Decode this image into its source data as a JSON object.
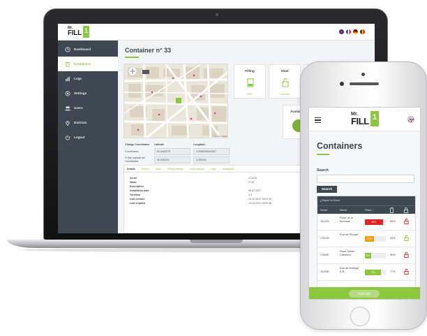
{
  "colors": {
    "brand_green": "#8dc63f",
    "sidebar_dark": "#3d4850",
    "fill_red": "#e02424",
    "fill_orange": "#f39c12",
    "fill_green": "#8dc63f"
  },
  "brand": {
    "logo_top": "Mr.",
    "logo_bottom": "FILL",
    "logo_badge": "1"
  },
  "desktop": {
    "sidebar": {
      "items": [
        {
          "label": "Dashboard",
          "icon": "clock-icon"
        },
        {
          "label": "Containers",
          "icon": "bin-icon"
        },
        {
          "label": "Logs",
          "icon": "bar-chart-icon"
        },
        {
          "label": "Settings",
          "icon": "gear-icon"
        },
        {
          "label": "Users",
          "icon": "users-icon"
        },
        {
          "label": "Districts",
          "icon": "map-pin-icon"
        },
        {
          "label": "Logout",
          "icon": "power-icon"
        }
      ],
      "active_index": 1
    },
    "page_title": "Container n° 33",
    "cards": [
      {
        "title": "Filling",
        "value": "33%"
      },
      {
        "title": "State",
        "value": "Unlocked"
      },
      {
        "title": "Batt",
        "value": ""
      }
    ],
    "availability": {
      "title": "Availability"
    },
    "coords": {
      "change_label": "Change Coordinates",
      "latitude_label": "Latitude",
      "longitude_label": "Longitude",
      "row1_label": "Coordinates",
      "row2_label": "© Use manual set Coordinates",
      "latitude_value_1": "50.8463275",
      "longitude_value_1": "4.3556296444087",
      "latitude_value_2": "50.846303",
      "longitude_value_2": "4.355431"
    },
    "tabs": [
      "Details",
      "History",
      "Stats",
      "Filling settings",
      "Lock settings",
      "Logs",
      "Availability"
    ],
    "details": [
      {
        "label": "Serial",
        "value": "171125"
      },
      {
        "label": "Name",
        "value": "171E"
      },
      {
        "label": "Description",
        "value": ""
      },
      {
        "label": "Installation date",
        "value": "06.07.2017"
      },
      {
        "label": "Variation",
        "value": "4.2"
      },
      {
        "label": "Last contact",
        "value": "13-12-2017 13:37:32"
      },
      {
        "label": "Last emptied",
        "value": "13-12-2017 09:52:48"
      }
    ]
  },
  "mobile": {
    "page_title": "Containers",
    "search_label": "Search",
    "search_placeholder": "",
    "search_button": "Search",
    "export_label": "Export to Excel",
    "columns": {
      "serial": "Serial",
      "street": "Street",
      "filled": "Filled ↓"
    },
    "rows": [
      {
        "serial": "161125",
        "street": "Place de la Monnaie",
        "fill": 85,
        "fill_label": "85%",
        "bar_color": "#e02424",
        "pct": "85%"
      },
      {
        "serial": "178133",
        "street": "Rue de l'Écuyer",
        "fill": 44,
        "fill_label": "44%",
        "bar_color": "#f39c12",
        "pct": "44%"
      },
      {
        "serial": "178087",
        "street": "Place Sainte Catherine",
        "fill": 30,
        "fill_label": "30%",
        "bar_color": "#8dc63f",
        "pct": "30%"
      },
      {
        "serial": "161082",
        "street": "Rue de Manège A.B.",
        "fill": 77,
        "fill_label": "77%",
        "bar_color": "#8dc63f",
        "pct": "77%"
      }
    ],
    "scan_button": "Scan QR"
  }
}
